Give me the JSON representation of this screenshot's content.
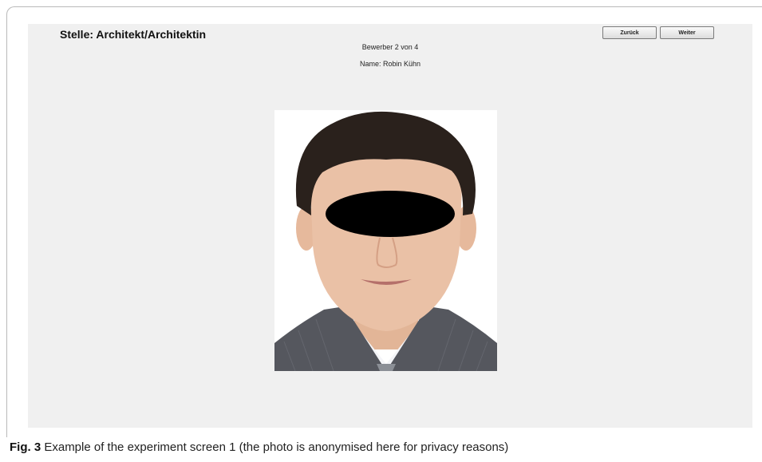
{
  "screen": {
    "job_title": "Stelle: Architekt/Architektin",
    "applicant_counter": "Bewerber 2 von 4",
    "applicant_name": "Name: Robin Kühn",
    "buttons": {
      "back": "Zurück",
      "next": "Weiter"
    },
    "photo": {
      "subject": "applicant-portrait",
      "eyes_censored": true
    }
  },
  "figure_caption": {
    "label": "Fig. 3",
    "text": "Example of the experiment screen 1 (the photo is anonymised here for privacy reasons)"
  },
  "colors": {
    "screen_background": "#f0f0f0",
    "censor_bar": "#000000",
    "suit": "#55575e",
    "skin": "#eac1a6",
    "hair": "#2a211c"
  }
}
